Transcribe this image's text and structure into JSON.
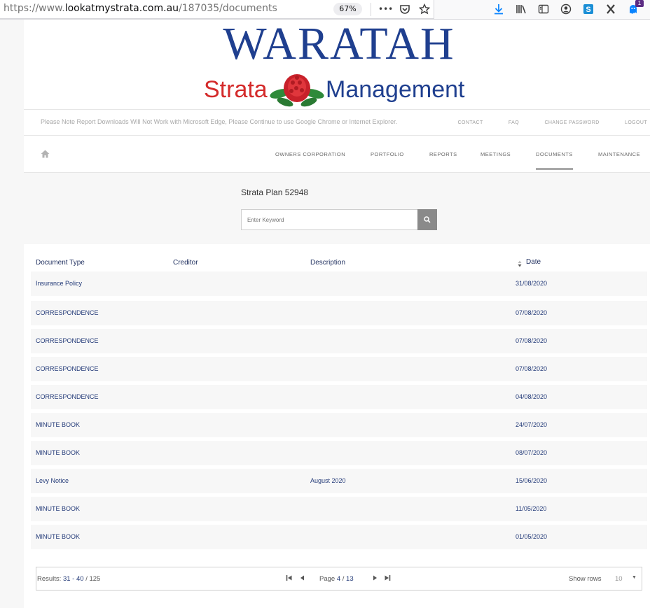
{
  "browser": {
    "url_prefix": "https://www.",
    "url_host": "lookatmystrata.com.au",
    "url_path": "/187035/documents",
    "zoom": "67%",
    "menu_dots": "•••",
    "badge_count": "1"
  },
  "logo": {
    "brand": "WARATAH",
    "word1": "Strata",
    "word2": "Management"
  },
  "notice": "Please Note Report Downloads Will Not Work with Microsoft Edge, Please Continue to use Google Chrome or Internet Explorer.",
  "toplinks": [
    "CONTACT",
    "FAQ",
    "CHANGE PASSWORD",
    "LOGOUT"
  ],
  "nav": {
    "items": [
      "OWNERS CORPORATION",
      "PORTFOLIO",
      "REPORTS",
      "MEETINGS",
      "DOCUMENTS",
      "MAINTENANCE"
    ],
    "active": "DOCUMENTS"
  },
  "plan_title": "Strata Plan 52948",
  "search": {
    "placeholder": "Enter Keyword"
  },
  "table": {
    "headers": [
      "Document Type",
      "Creditor",
      "Description",
      "Date"
    ],
    "rows": [
      {
        "type": "Insurance Policy",
        "creditor": "",
        "description": "",
        "date": "31/08/2020"
      },
      {
        "type": "CORRESPONDENCE",
        "creditor": "",
        "description": "",
        "date": "07/08/2020"
      },
      {
        "type": "CORRESPONDENCE",
        "creditor": "",
        "description": "",
        "date": "07/08/2020"
      },
      {
        "type": "CORRESPONDENCE",
        "creditor": "",
        "description": "",
        "date": "07/08/2020"
      },
      {
        "type": "CORRESPONDENCE",
        "creditor": "",
        "description": "",
        "date": "04/08/2020"
      },
      {
        "type": "MINUTE BOOK",
        "creditor": "",
        "description": "",
        "date": "24/07/2020"
      },
      {
        "type": "MINUTE BOOK",
        "creditor": "",
        "description": "",
        "date": "08/07/2020"
      },
      {
        "type": "Levy Notice",
        "creditor": "",
        "description": "August 2020",
        "date": "15/06/2020"
      },
      {
        "type": "MINUTE BOOK",
        "creditor": "",
        "description": "",
        "date": "11/05/2020"
      },
      {
        "type": "MINUTE BOOK",
        "creditor": "",
        "description": "",
        "date": "01/05/2020"
      }
    ]
  },
  "pager": {
    "results_label": "Results:",
    "results_range": "31 - 40",
    "results_sep": "/",
    "results_total": "125",
    "page_label": "Page",
    "page_current": "4",
    "page_sep": "/",
    "page_total": "13",
    "show_rows_label": "Show rows",
    "rows_value": "10"
  },
  "colors": {
    "link": "#233a78",
    "brand_blue": "#1f3f8f",
    "brand_red": "#d42a2a"
  }
}
